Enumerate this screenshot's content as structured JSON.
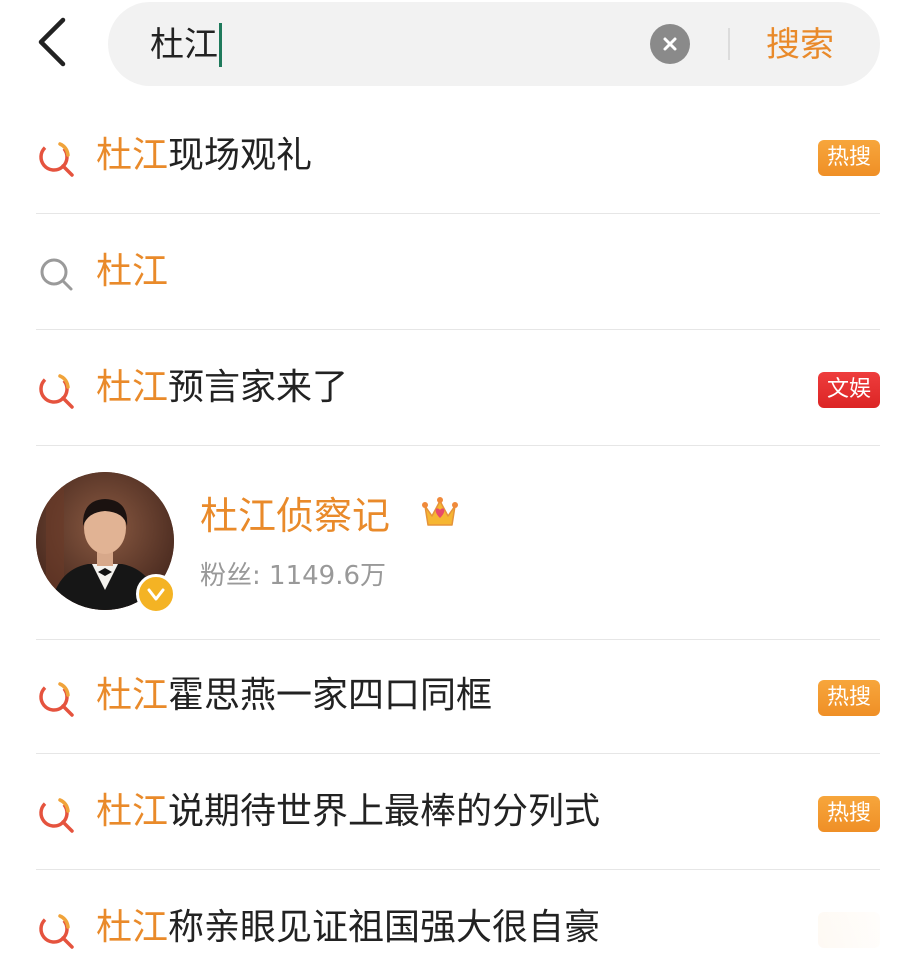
{
  "header": {
    "search_query": "杜江",
    "search_button": "搜索"
  },
  "suggestions": [
    {
      "highlight": "杜江",
      "rest": "现场观礼",
      "badge": "热搜",
      "icon": "hot-search-icon"
    },
    {
      "highlight": "杜江",
      "rest": "",
      "badge": "",
      "icon": "search-icon"
    },
    {
      "highlight": "杜江",
      "rest": "预言家来了",
      "badge": "文娱",
      "icon": "hot-search-icon"
    },
    {
      "highlight": "杜江",
      "rest": "霍思燕一家四口同框",
      "badge": "热搜",
      "icon": "hot-search-icon"
    },
    {
      "highlight": "杜江",
      "rest": "说期待世界上最棒的分列式",
      "badge": "热搜",
      "icon": "hot-search-icon"
    },
    {
      "highlight": "杜江",
      "rest": "称亲眼见证祖国强大很自豪",
      "badge": "",
      "icon": "hot-search-icon"
    }
  ],
  "user": {
    "name": "杜江侦察记",
    "fans": "粉丝: 1149.6万",
    "icons": [
      "avatar",
      "verified-badge-icon",
      "crown-icon"
    ]
  },
  "colors": {
    "accent": "#e98a2a",
    "hot_badge": "#f39a2f",
    "ent_badge": "#e53030",
    "icon_red": "#e5533e",
    "icon_orange": "#f0a33a"
  }
}
